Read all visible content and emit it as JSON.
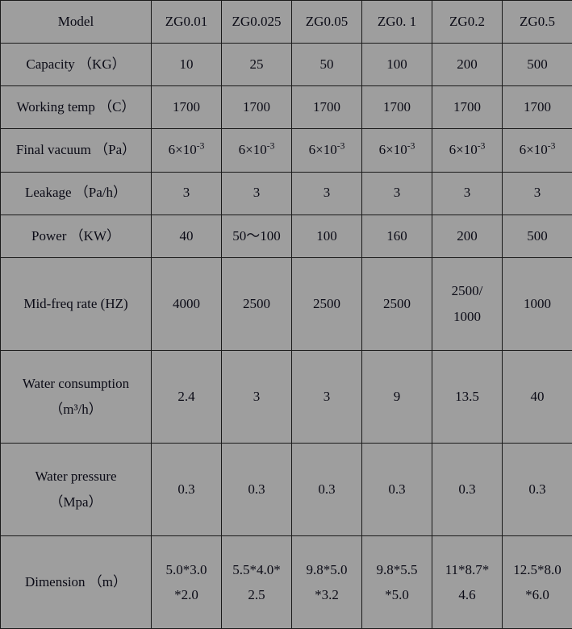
{
  "table": {
    "row_label_header": "Model",
    "columns": [
      "ZG0.01",
      "ZG0.025",
      "ZG0.05",
      "ZG0. 1",
      "ZG0.2",
      "ZG0.5"
    ],
    "rows": [
      {
        "label": "Capacity （KG）",
        "values": [
          "10",
          "25",
          "50",
          "100",
          "200",
          "500"
        ]
      },
      {
        "label": "Working temp （C）",
        "values": [
          "1700",
          "1700",
          "1700",
          "1700",
          "1700",
          "1700"
        ]
      },
      {
        "label": "Final vacuum （Pa）",
        "values": [
          "6×10-3",
          "6×10-3",
          "6×10-3",
          "6×10-3",
          "6×10-3",
          "6×10-3"
        ]
      },
      {
        "label": "Leakage （Pa/h）",
        "values": [
          "3",
          "3",
          "3",
          "3",
          "3",
          "3"
        ]
      },
      {
        "label": "Power （KW）",
        "values": [
          "40",
          "50～100",
          "100",
          "160",
          "200",
          "500"
        ]
      },
      {
        "label": "Mid-freq rate (HZ)",
        "values": [
          "4000",
          "2500",
          "2500",
          "2500",
          "2500/ 1000",
          "1000"
        ]
      },
      {
        "label": "Water consumption （m³/h）",
        "values": [
          "2.4",
          "3",
          "3",
          "9",
          "13.5",
          "40"
        ]
      },
      {
        "label": "Water pressure （Mpa）",
        "values": [
          "0.3",
          "0.3",
          "0.3",
          "0.3",
          "0.3",
          "0.3"
        ]
      },
      {
        "label": "Dimension  （m）",
        "values": [
          "5.0*3.0 *2.0",
          "5.5*4.0* 2.5",
          "9.8*5.0 *3.2",
          "9.8*5.5 *5.0",
          "11*8.7* 4.6",
          "12.5*8.0 *6.0"
        ]
      }
    ],
    "label_lines": {
      "capacity": [
        "Capacity （KG）"
      ],
      "working_temp": [
        "Working temp （C）"
      ],
      "final_vacuum": [
        "Final vacuum （Pa）"
      ],
      "leakage": [
        "Leakage （Pa/h）"
      ],
      "power": [
        "Power （KW）"
      ],
      "mid_freq": [
        "Mid-freq rate (HZ)"
      ],
      "water_consumption_l1": "Water consumption",
      "water_consumption_l2": "（m³/h）",
      "water_pressure_l1": "Water pressure",
      "water_pressure_l2": "（Mpa）",
      "dimension": "Dimension  （m）"
    },
    "cells": {
      "final_vacuum_base": "6×10",
      "final_vacuum_exp": "-3",
      "power_c2": "50～100",
      "mid_freq_c5_l1": "2500/",
      "mid_freq_c5_l2": "1000",
      "dim_c1_l1": "5.0*3.0",
      "dim_c1_l2": "*2.0",
      "dim_c2_l1": "5.5*4.0*",
      "dim_c2_l2": "2.5",
      "dim_c3_l1": "9.8*5.0",
      "dim_c3_l2": "*3.2",
      "dim_c4_l1": "9.8*5.5",
      "dim_c4_l2": "*5.0",
      "dim_c5_l1": "11*8.7*",
      "dim_c5_l2": "4.6",
      "dim_c6_l1": "12.5*8.0",
      "dim_c6_l2": "*6.0"
    }
  },
  "colors": {
    "shade_medium": "#9e9e9e",
    "shade_dark": "#808080",
    "shade_light": "#e3e3e3",
    "border": "#1a1a1a",
    "text": "#0b0b16"
  }
}
